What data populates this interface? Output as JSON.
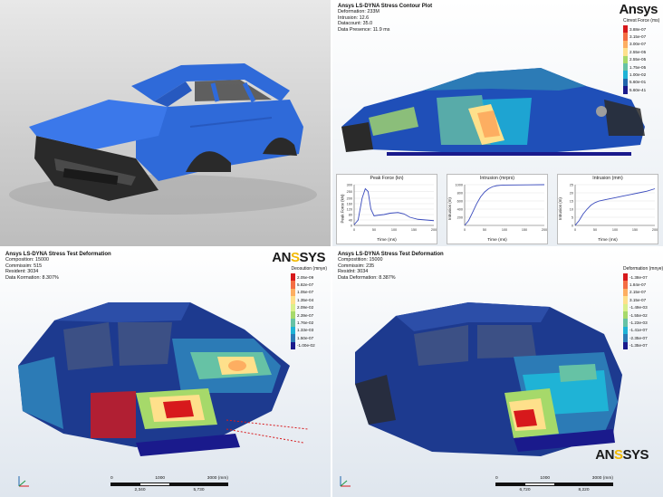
{
  "brand": {
    "logo_prefix": "AN",
    "logo_a": "",
    "logo_suffix": "SYS",
    "logo_text_mid": "Ansys"
  },
  "panel2": {
    "title": "Ansys LS-DYNA Stress Contour Plot",
    "lines": [
      "Deformation: 233M",
      "Intrusion: 12.6",
      "Datacount: 35.0",
      "Data Presence: 11.9 ms"
    ],
    "legend_title": "Cirrest Force (ms)",
    "legend_labels": [
      "3.88e-07",
      "3.15e-07",
      "3.00e-07",
      "2.55e-05",
      "2.55e-05",
      "1.75e-05",
      "1.00e-02",
      "5.60e-01",
      "5.60e-41"
    ],
    "legend_colors": [
      "#d7191c",
      "#f46d43",
      "#fdae61",
      "#fee08b",
      "#a6d96a",
      "#66c2a5",
      "#1fb3d6",
      "#2166ac",
      "#1a1a8c"
    ]
  },
  "charts": [
    {
      "title": "Peak Force (kn)",
      "xlabel": "Time (ms)",
      "ylabel": "Peak Force (kN)"
    },
    {
      "title": "Intrusion (mrprs)",
      "xlabel": "Time (ms)",
      "ylabel": "Intrusion (m)"
    },
    {
      "title": "Intrusion (mm)",
      "xlabel": "Time (ms)",
      "ylabel": "Intrusion (m)"
    }
  ],
  "chart_data": [
    {
      "type": "line",
      "title": "Peak Force (kn)",
      "xlabel": "Time (ms)",
      "ylabel": "Peak Force (kN)",
      "xlim": [
        0,
        200
      ],
      "ylim": [
        0,
        300
      ],
      "xticks": [
        0,
        50,
        100,
        150,
        200
      ],
      "yticks": [
        0,
        40,
        80,
        120,
        160,
        200,
        250,
        300
      ],
      "x": [
        0,
        10,
        20,
        28,
        35,
        42,
        50,
        60,
        75,
        90,
        110,
        125,
        140,
        160,
        180,
        200
      ],
      "y": [
        5,
        40,
        200,
        270,
        250,
        120,
        70,
        75,
        80,
        90,
        95,
        85,
        60,
        45,
        40,
        35
      ]
    },
    {
      "type": "line",
      "title": "Intrusion (mrprs)",
      "xlabel": "Time (ms)",
      "ylabel": "Intrusion (m)",
      "xlim": [
        0,
        200
      ],
      "ylim": [
        0,
        1000
      ],
      "xticks": [
        0,
        50,
        100,
        150,
        200
      ],
      "yticks": [
        200,
        400,
        600,
        800,
        1000
      ],
      "x": [
        0,
        10,
        20,
        30,
        40,
        50,
        60,
        70,
        80,
        90,
        100,
        130,
        160,
        200
      ],
      "y": [
        0,
        120,
        320,
        530,
        700,
        820,
        900,
        950,
        975,
        985,
        990,
        992,
        995,
        1000
      ]
    },
    {
      "type": "line",
      "title": "Intrusion (mm)",
      "xlabel": "Time (ms)",
      "ylabel": "Intrusion (m)",
      "xlim": [
        0,
        200
      ],
      "ylim": [
        0,
        25
      ],
      "xticks": [
        0,
        50,
        100,
        150,
        200
      ],
      "yticks": [
        0,
        5,
        10,
        15,
        20,
        25
      ],
      "x": [
        0,
        10,
        20,
        30,
        40,
        50,
        60,
        80,
        100,
        120,
        140,
        160,
        180,
        200
      ],
      "y": [
        0,
        3,
        7,
        10,
        12.5,
        14,
        15,
        16,
        17,
        18,
        19,
        20,
        21,
        22.5
      ]
    }
  ],
  "panel3": {
    "title": "Ansys LS-DYNA Stress Test Deformation",
    "lines": [
      "Composition: 15000",
      "Commissim: 515",
      "Resident: 3034",
      "Data Kormation: 8.307%"
    ],
    "legend_title": "Deosution (mnye)",
    "legend_labels": [
      "2.05e-09",
      "5.82e-07",
      "1.05e-07",
      "1.35e-04",
      "2.09e-02",
      "2.39e-07",
      "1.76e-02",
      "1.33e-03",
      "1.50e-07",
      "-1.00e-02"
    ],
    "legend_colors": [
      "#d7191c",
      "#f46d43",
      "#fdae61",
      "#fee08b",
      "#d9ef8b",
      "#a6d96a",
      "#66c2a5",
      "#1fb3d6",
      "#2c7bb6",
      "#1a1a8c"
    ],
    "scale_ticks": [
      "0",
      "1000",
      "3000 (mm)"
    ],
    "scale_values": [
      "2,340",
      "5,730"
    ]
  },
  "panel4": {
    "title": "Ansys LS-DYNA Stress Test Deformation",
    "lines": [
      "Compostition: 15000",
      "Commissim: 235",
      "Residnt: 3034",
      "Data Deformation: 8.387%"
    ],
    "legend_title": "Deformation (mnye)",
    "legend_labels": [
      "-1.38e-07",
      "1.84e-07",
      "2.15e-07",
      "3.15e-07",
      "-1.49e-03",
      "-1.55e-02",
      "-1.23e-03",
      "-1.41e-07",
      "-2.35e-07",
      "-1.35e-07"
    ],
    "legend_colors": [
      "#d7191c",
      "#f46d43",
      "#fdae61",
      "#fee08b",
      "#d9ef8b",
      "#a6d96a",
      "#66c2a5",
      "#1fb3d6",
      "#2c7bb6",
      "#1a1a8c"
    ],
    "scale_ticks": [
      "0",
      "1000",
      "3000 (mm)"
    ],
    "scale_values": [
      "6,720",
      "8,220"
    ]
  },
  "colors": {
    "car_blue": "#2f6ad9",
    "dark_blue": "#1d3a8f",
    "frame": "#2a2a2a",
    "accent": "#f2b900"
  }
}
